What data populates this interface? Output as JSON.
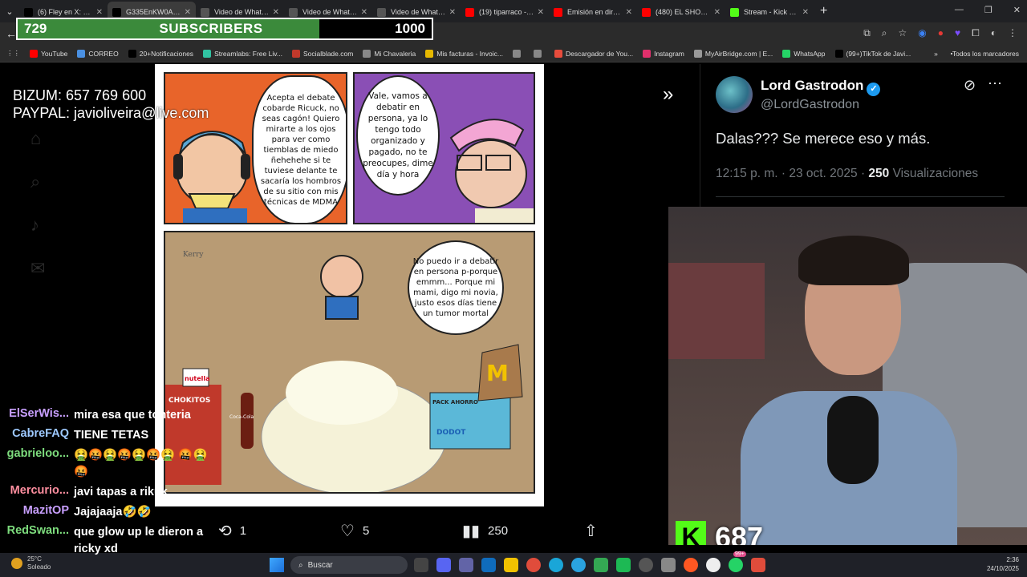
{
  "browser": {
    "tabs": [
      {
        "label": "(6) Fley en X: \"BAC",
        "active": false,
        "favicon": "x-icon",
        "color": "#000000"
      },
      {
        "label": "G335EnKW0AA5sE",
        "active": true,
        "favicon": "x-icon",
        "color": "#000000"
      },
      {
        "label": "Video de WhatsApp",
        "active": false,
        "favicon": "globe-icon",
        "color": "#555555"
      },
      {
        "label": "Video de WhatsApp",
        "active": false,
        "favicon": "globe-icon",
        "color": "#555555"
      },
      {
        "label": "Video de WhatsApp",
        "active": false,
        "favicon": "globe-icon",
        "color": "#555555"
      },
      {
        "label": "(19) tiparraco - Yo",
        "active": false,
        "favicon": "youtube-icon",
        "color": "#ff0000"
      },
      {
        "label": "Emisión en directo",
        "active": false,
        "favicon": "youtube-icon",
        "color": "#ff0000"
      },
      {
        "label": "(480) EL SHOW DE",
        "active": false,
        "favicon": "youtube-icon",
        "color": "#ff0000"
      },
      {
        "label": "Stream - Kick Das",
        "active": false,
        "favicon": "kick-icon",
        "color": "#53fc18"
      }
    ],
    "bookmarks": [
      {
        "label": "YouTube",
        "color": "#ff0000"
      },
      {
        "label": "CORREO",
        "color": "#4a90e2"
      },
      {
        "label": "20+Notificaciones",
        "color": "#000000"
      },
      {
        "label": "Streamlabs: Free Liv...",
        "color": "#31c3a2"
      },
      {
        "label": "Socialblade.com",
        "color": "#c0392b"
      },
      {
        "label": "Mi Chavaleria",
        "color": "#888888"
      },
      {
        "label": "Mis facturas - Invoic...",
        "color": "#e6b800"
      },
      {
        "label": "",
        "color": "#888888"
      },
      {
        "label": "",
        "color": "#888888"
      },
      {
        "label": "Descargador de You...",
        "color": "#e74c3c"
      },
      {
        "label": "Instagram",
        "color": "#e1306c"
      },
      {
        "label": "MyAirBridge.com | E...",
        "color": "#999999"
      },
      {
        "label": "WhatsApp",
        "color": "#25d366"
      },
      {
        "label": "(99+)TikTok de Javi...",
        "color": "#000000"
      }
    ],
    "bookmarks_folder": "Todos los marcadores"
  },
  "subscriber_goal": {
    "current": "729",
    "title": "SUBSCRIBERS",
    "goal": "1000",
    "progress": 0.729,
    "fill_color": "#3b8a3b"
  },
  "donations": {
    "bizum": "BIZUM: 657 769 600",
    "paypal": "PAYPAL: javioliveira@live.com"
  },
  "comic": {
    "bubble1": "Acepta el debate cobarde Ricuck, no seas cagón! Quiero mirarte a los ojos para ver como tiemblas de miedo ñehehehe si te tuviese delante te sacaría los hombros de su sitio con mis técnicas de MDMA",
    "bubble2": "Vale, vamos a debatir en persona, ya lo tengo todo organizado y pagado, no te preocupes, dime día y hora",
    "bubble3": "No puedo ir a debatir en persona p-porque emmm... Porque mi mami, digo mi novia, justo esos días tiene un tumor mortal",
    "signature": "Kerry",
    "products": [
      "nutella",
      "CHOKITOS",
      "Coca-Cola",
      "PACK AHORRO",
      "DODOT"
    ]
  },
  "tweet": {
    "name": "Lord Gastrodon",
    "handle": "@LordGastrodon",
    "text": "Dalas??? Se merece eso y más.",
    "time": "12:15 p. m. · 23 oct. 2025 · ",
    "views_count": "250",
    "views_label": " Visualizaciones"
  },
  "tweet_actions": {
    "retweets": "1",
    "likes": "5",
    "views": "250"
  },
  "kick": {
    "badge": "K",
    "viewers": "687",
    "color": "#53fc18"
  },
  "chat": [
    {
      "user": "ElSerWis...",
      "color": "#c9a0ff",
      "msg": "mira esa que tonteria"
    },
    {
      "user": "CabreFAQ",
      "color": "#9ec9ff",
      "msg": "TIENE TETAS"
    },
    {
      "user": "gabrieloo...",
      "color": "#7ddc7d",
      "msg": "🤮🤬🤮🤬🤮🤬🤮 🤬🤮🤬"
    },
    {
      "user": "Mercurio...",
      "color": "#ff8fa0",
      "msg": "javi tapas a rikuk"
    },
    {
      "user": "MazitOP",
      "color": "#c9a0ff",
      "msg": "Jajajaaja🤣🤣"
    },
    {
      "user": "RedSwan...",
      "color": "#7ddc7d",
      "msg": "que glow up le dieron a ricky xd"
    }
  ],
  "taskbar": {
    "temp": "25°C",
    "weather": "Soleado",
    "search": "Buscar",
    "time": "2:36",
    "date": "24/10/2025",
    "badge": "99+"
  }
}
